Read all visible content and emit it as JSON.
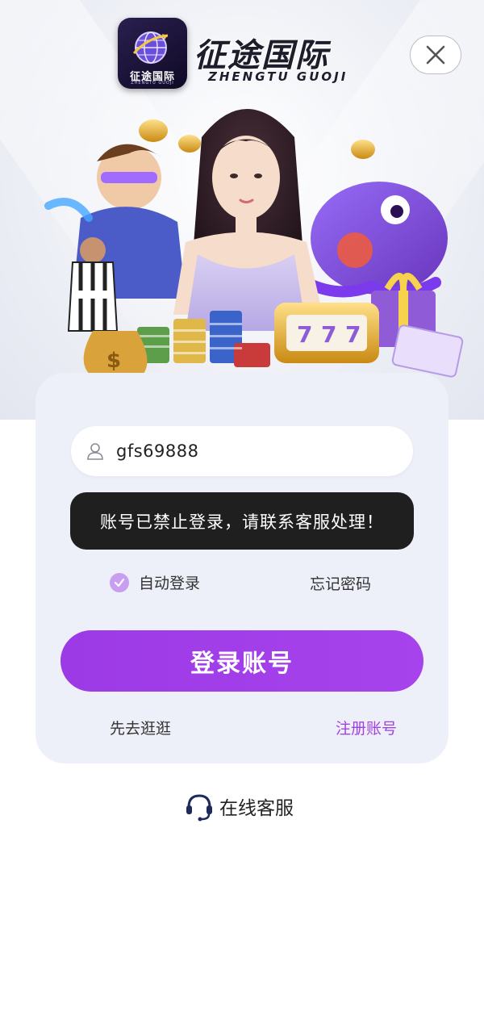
{
  "brand": {
    "logo_text": "征途国际",
    "logo_subtext": "ZHENGTU GUOJI",
    "title": "征途国际",
    "subtitle": "ZHENGTU GUOJI"
  },
  "form": {
    "username_value": "gfs69888",
    "error_toast": "账号已禁止登录，请联系客服处理！",
    "auto_login_label": "自动登录",
    "auto_login_checked": true,
    "forgot_password_label": "忘记密码",
    "login_button_label": "登录账号",
    "browse_label": "先去逛逛",
    "register_label": "注册账号"
  },
  "support": {
    "label": "在线客服"
  },
  "colors": {
    "accent": "#a243e0",
    "button": "#9c3ae6",
    "checkbox": "#c79ef0",
    "card_bg": "#eef0f9",
    "toast_bg": "#1f1f1f"
  },
  "icons": {
    "close": "close-icon",
    "user": "user-icon",
    "check": "check-icon",
    "headset": "headset-icon"
  }
}
